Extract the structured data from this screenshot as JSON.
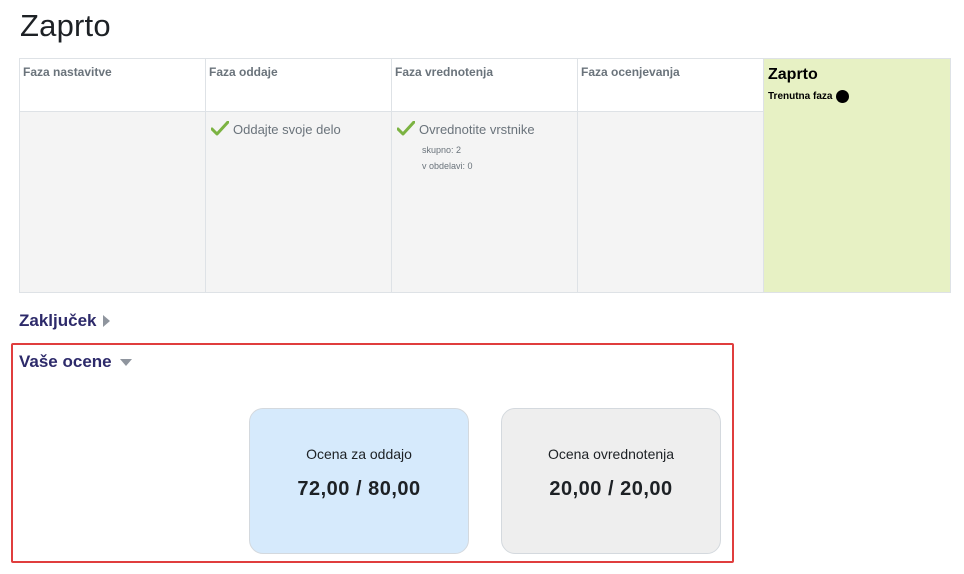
{
  "page": {
    "title": "Zaprto"
  },
  "phases": [
    {
      "name": "Faza nastavitve",
      "tasks": []
    },
    {
      "name": "Faza oddaje",
      "tasks": [
        {
          "label": "Oddajte svoje delo",
          "done": true
        }
      ]
    },
    {
      "name": "Faza vrednotenja",
      "tasks": [
        {
          "label": "Ovrednotite vrstnike",
          "done": true,
          "details": [
            "skupno: 2",
            "v obdelavi: 0"
          ]
        }
      ]
    },
    {
      "name": "Faza ocenjevanja",
      "tasks": []
    },
    {
      "name": "Zaprto",
      "current_label": "Trenutna faza",
      "tasks": []
    }
  ],
  "sections": {
    "conclusion": {
      "label": "Zaključek",
      "expanded": false
    },
    "grades": {
      "label": "Vaše ocene",
      "expanded": true
    }
  },
  "grades": [
    {
      "label": "Ocena za oddajo",
      "value": "72,00 / 80,00",
      "color": "#d6eafc"
    },
    {
      "label": "Ocena ovrednotenja",
      "value": "20,00 / 20,00",
      "color": "#eeeeee"
    }
  ],
  "colors": {
    "current_phase": "#e7f1c4",
    "check": "#7cb342",
    "link": "#2d2a6a",
    "highlight": "#e03e3e"
  }
}
